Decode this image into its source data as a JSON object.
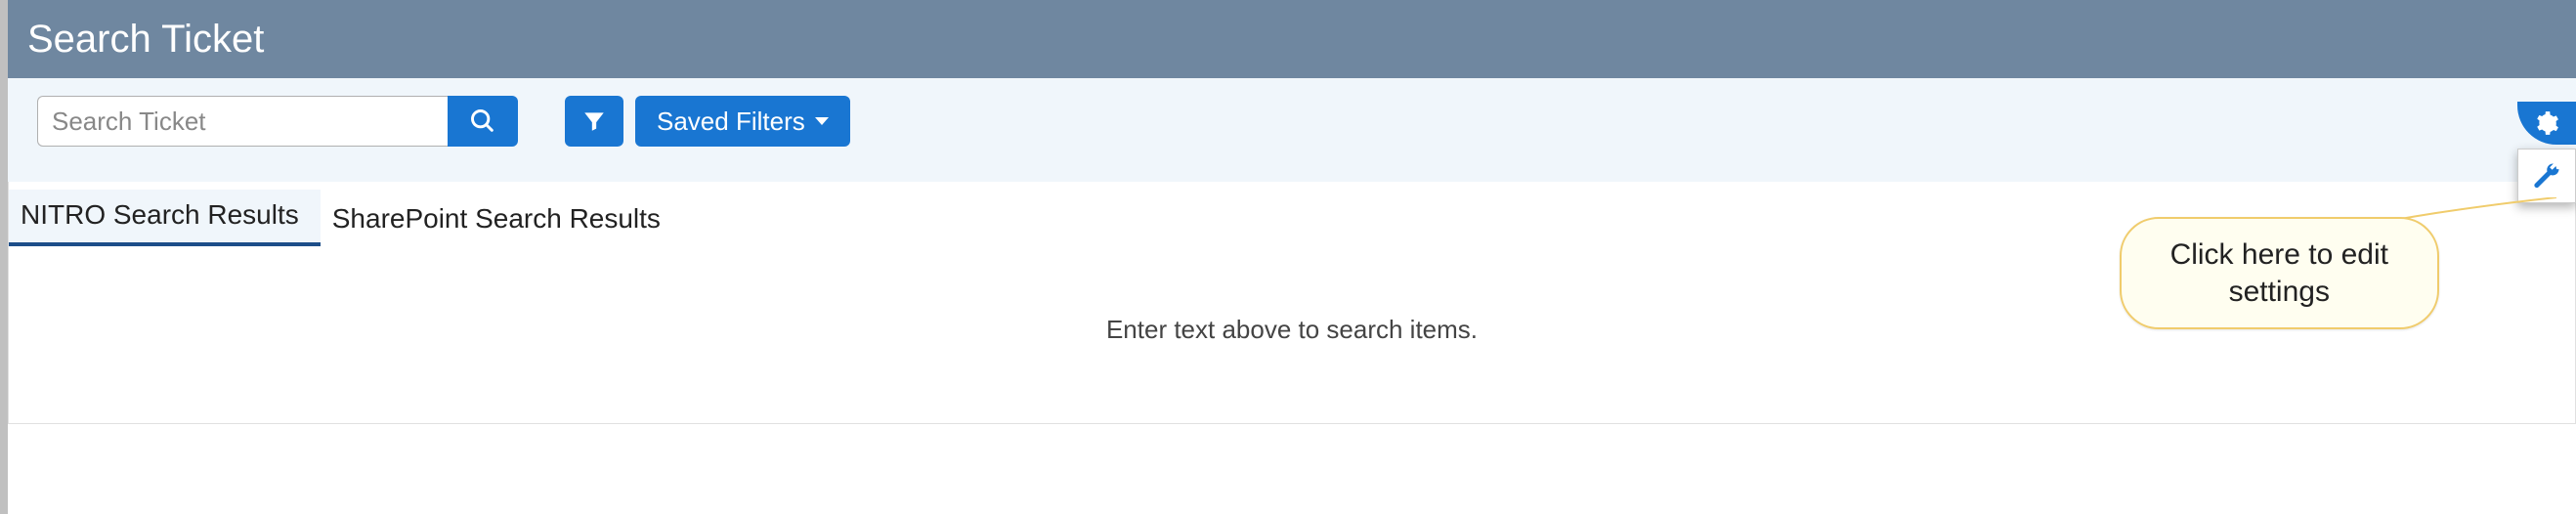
{
  "header": {
    "title": "Search Ticket"
  },
  "search": {
    "placeholder": "Search Ticket",
    "value": ""
  },
  "buttons": {
    "saved_filters": "Saved Filters"
  },
  "tabs": [
    {
      "label": "NITRO Search Results",
      "active": true
    },
    {
      "label": "SharePoint Search Results",
      "active": false
    }
  ],
  "content": {
    "empty_message": "Enter text above to search items."
  },
  "callout": {
    "line1": "Click here to edit",
    "line2": "settings"
  },
  "icons": {
    "search": "search-icon",
    "filter": "filter-icon",
    "gear": "gear-icon",
    "wrench": "wrench-icon"
  },
  "colors": {
    "header_bg": "#6f87a0",
    "toolbar_bg": "#f0f6fb",
    "primary": "#1976d2",
    "tab_underline": "#1d4e89",
    "callout_bg": "#fffef0",
    "callout_border": "#f0cc6c"
  }
}
